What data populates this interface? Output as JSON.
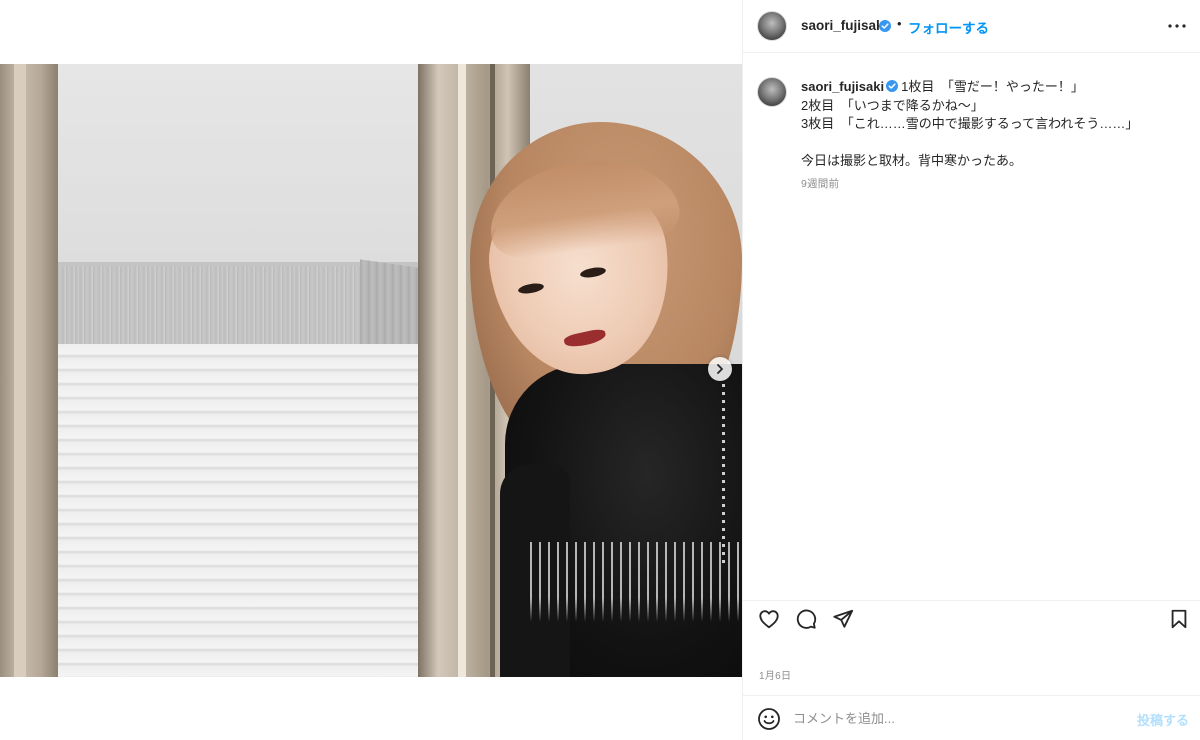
{
  "post": {
    "media_alt": "",
    "carousel_next_icon": "chevron-right-icon"
  },
  "header": {
    "username": "saori_fujisaki",
    "separator": "•",
    "follow_label": "フォローする",
    "more_icon": "more-horizontal-icon"
  },
  "caption": {
    "username": "saori_fujisaki",
    "lines": [
      "1枚目　「雪だー！やったー！」",
      "2枚目　「いつまで降るかね〜」",
      "3枚目　「これ……雪の中で撮影するって言われそう……」",
      "今日は撮影と取材。背中寒かったあ。"
    ],
    "time_ago": "9週間前"
  },
  "actions": {
    "like_icon": "heart-icon",
    "comment_icon": "comment-icon",
    "share_icon": "paper-plane-icon",
    "save_icon": "bookmark-icon"
  },
  "date": "1月6日",
  "comment_box": {
    "emoji_icon": "smiley-icon",
    "placeholder": "コメントを追加...",
    "post_label": "投稿する"
  },
  "colors": {
    "accent": "#0095f6",
    "post_disabled": "#b2dffc",
    "text": "#262626",
    "muted": "#8e8e8e",
    "divider": "#efefef"
  }
}
